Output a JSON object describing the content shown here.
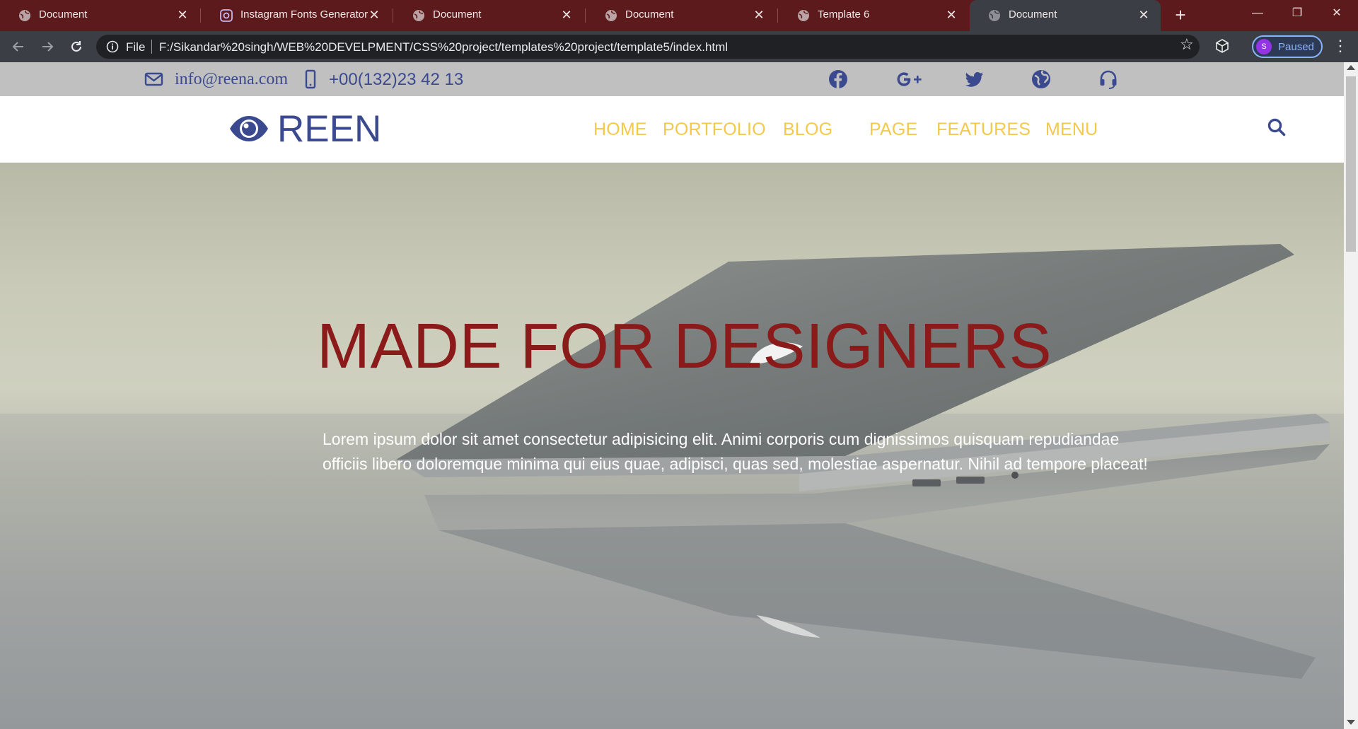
{
  "browser": {
    "tabs": [
      {
        "title": "Document",
        "active": false
      },
      {
        "title": "Instagram Fonts Generator (𝒸",
        "active": false
      },
      {
        "title": "Document",
        "active": false
      },
      {
        "title": "Document",
        "active": false
      },
      {
        "title": "Template 6",
        "active": false
      },
      {
        "title": "Document",
        "active": true
      }
    ],
    "new_tab": "+",
    "close": "✕",
    "window": {
      "minimize": "—",
      "restore": "❐",
      "close": "✕"
    },
    "omnibox": {
      "scheme_label": "File",
      "url": "F:/Sikandar%20singh/WEB%20DEVELPMENT/CSS%20project/templates%20project/template5/index.html"
    },
    "profile": {
      "initial": "S",
      "status": "Paused"
    },
    "colors": {
      "tabstrip": "#5c1a1c",
      "toolbar": "#3b3f45",
      "omnibox": "#202124"
    }
  },
  "page": {
    "topbar": {
      "email": "info@reena.com",
      "phone": "+00(132)23 42 13",
      "social": [
        "facebook-icon",
        "google-plus-icon",
        "twitter-icon",
        "globe-icon",
        "headset-icon"
      ]
    },
    "navbar": {
      "brand": "REEN",
      "links": [
        "HOME",
        "PORTFOLIO",
        "BLOG",
        "PAGE",
        "FEATURES",
        "MENU"
      ],
      "search_icon": "search-icon"
    },
    "hero": {
      "title": "MADE FOR DESIGNERS",
      "text": "Lorem ipsum dolor sit amet consectetur adipisicing elit. Animi corporis cum dignissimos quisquam repudiandae officiis libero doloremque minima qui eius quae, adipisci, quas sed, molestiae aspernatur. Nihil ad tempore placeat!"
    },
    "colors": {
      "brand": "#3b4a8e",
      "nav_link": "#f2c94c",
      "hero_title": "#8b1a1a",
      "topbar": "#c0c0c0"
    }
  }
}
